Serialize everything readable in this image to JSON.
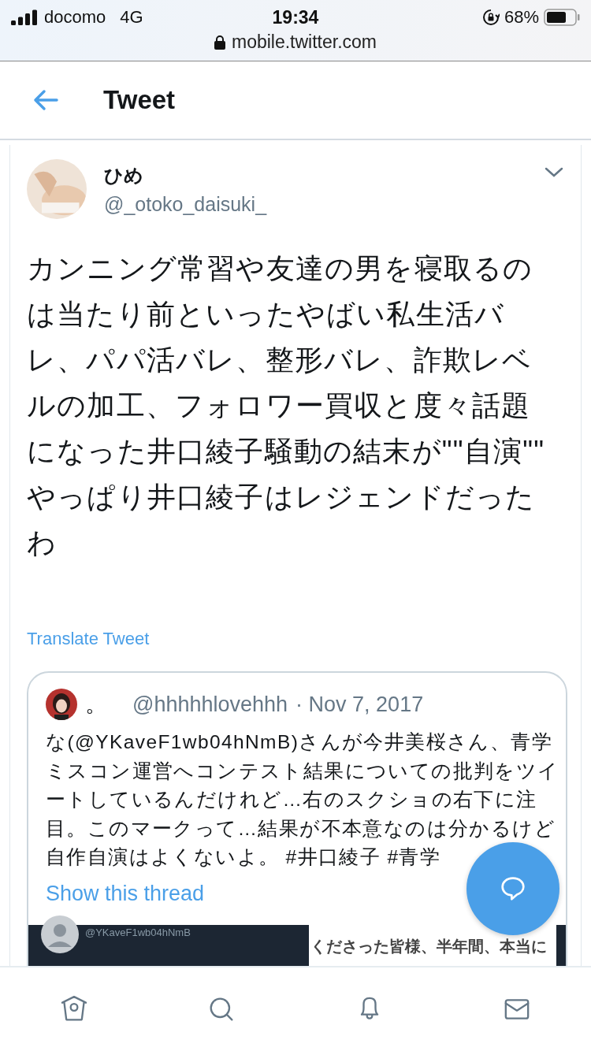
{
  "status_bar": {
    "carrier": "docomo",
    "network": "4G",
    "time": "19:34",
    "battery": "68%",
    "url": "mobile.twitter.com"
  },
  "header": {
    "title": "Tweet"
  },
  "tweet": {
    "name": "ひめ",
    "handle": "@_otoko_daisuki_",
    "text": "カンニング常習や友達の男を寝取るのは当たり前といったやばい私生活バレ、パパ活バレ、整形バレ、詐欺レベルの加工、フォロワー買収と度々話題になった井口綾子騒動の結末が\"\"自演\"\"\nやっぱり井口綾子はレジェンドだったわ",
    "translate": "Translate Tweet",
    "quote": {
      "name": "。",
      "handle": "@hhhhhlovehhh",
      "date": "· Nov 7, 2017",
      "text": "な(@YKaveF1wb04hNmB)さんが今井美桜さん、青学ミスコン運営へコンテスト結果についての批判をツイートしているんだけれど…右のスクショの右下に注目。このマークって…結果が不本意なのは分かるけど自作自演はよくないよ。 #井口綾子 #青学",
      "thread": "Show this thread",
      "image": {
        "left_handle": "@YKaveF1wb04hNmB",
        "right_text": "くださった皆様、半年間、本当に"
      }
    }
  },
  "nav": [
    {
      "kind": "home",
      "selected": false
    },
    {
      "kind": "search",
      "selected": false
    },
    {
      "kind": "bell",
      "selected": false
    },
    {
      "kind": "mail",
      "selected": false
    }
  ]
}
